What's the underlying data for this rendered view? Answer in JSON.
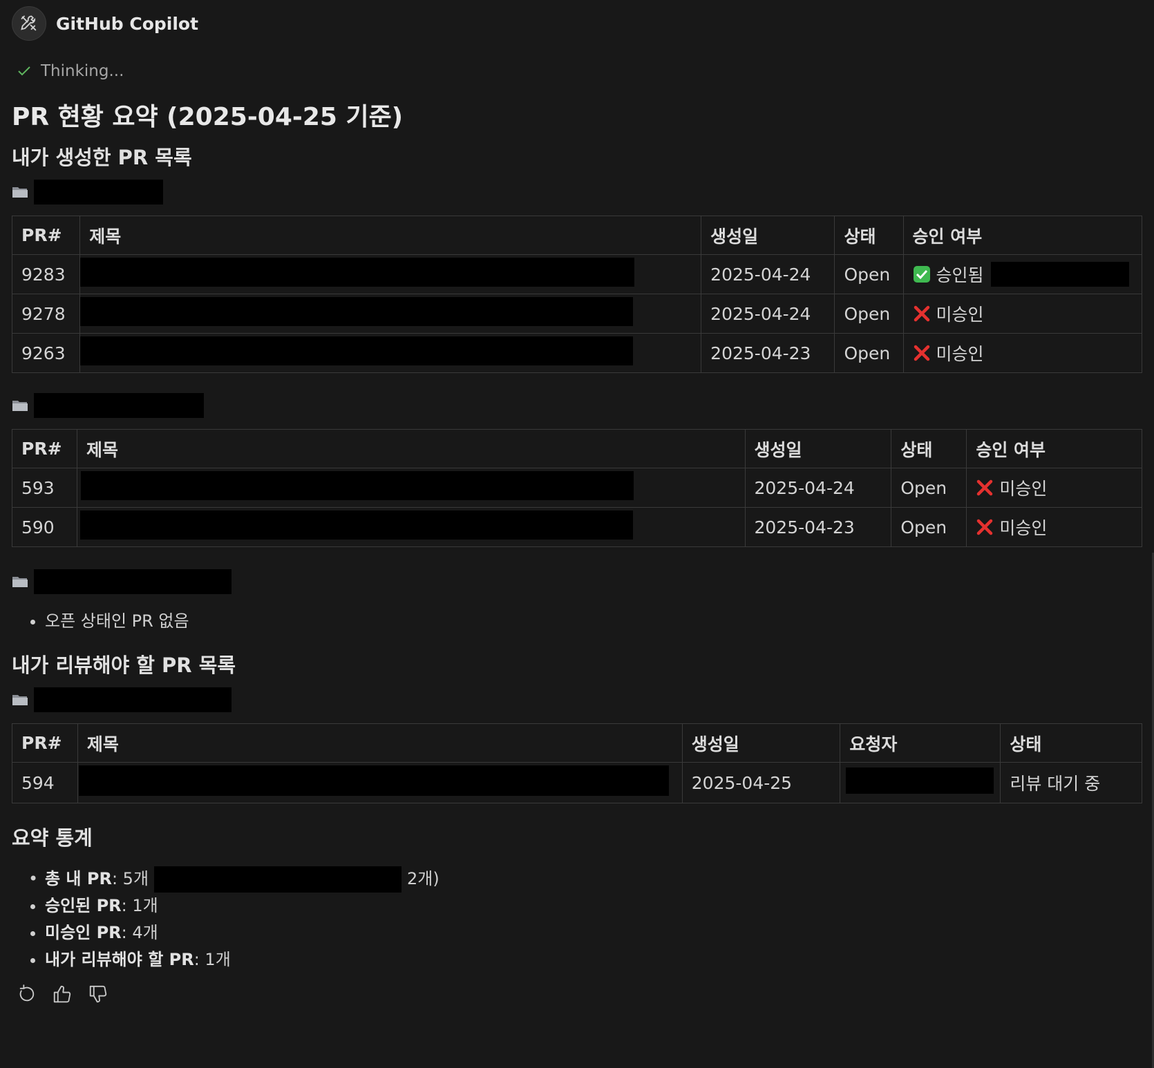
{
  "header": {
    "agent_name": "GitHub Copilot",
    "avatar_icon": "tools-icon"
  },
  "status": {
    "text": "Thinking...",
    "icon": "check-icon",
    "color": "#5fb55f"
  },
  "title": "PR 현황 요약 (2025-04-25 기준)",
  "sections": {
    "mine": "내가 생성한 PR 목록",
    "review": "내가 리뷰해야 할 PR 목록",
    "stats": "요약 통계"
  },
  "repo1": {
    "headers": [
      "PR#",
      "제목",
      "생성일",
      "상태",
      "승인 여부"
    ],
    "rows": [
      {
        "num": "9283",
        "date": "2025-04-24",
        "status": "Open",
        "approval": "승인됨",
        "approved": true
      },
      {
        "num": "9278",
        "date": "2025-04-24",
        "status": "Open",
        "approval": "미승인",
        "approved": false
      },
      {
        "num": "9263",
        "date": "2025-04-23",
        "status": "Open",
        "approval": "미승인",
        "approved": false
      }
    ]
  },
  "repo2": {
    "headers": [
      "PR#",
      "제목",
      "생성일",
      "상태",
      "승인 여부"
    ],
    "rows": [
      {
        "num": "593",
        "date": "2025-04-24",
        "status": "Open",
        "approval": "미승인",
        "approved": false
      },
      {
        "num": "590",
        "date": "2025-04-23",
        "status": "Open",
        "approval": "미승인",
        "approved": false
      }
    ]
  },
  "repo3": {
    "note": "오픈 상태인 PR 없음"
  },
  "review_repo": {
    "headers": [
      "PR#",
      "제목",
      "생성일",
      "요청자",
      "상태"
    ],
    "rows": [
      {
        "num": "594",
        "date": "2025-04-25",
        "status": "리뷰 대기 중"
      }
    ]
  },
  "stats": [
    {
      "label": "총 내 PR",
      "value": ": 5개",
      "tail": "2개)"
    },
    {
      "label": "승인된 PR",
      "value": ": 1개"
    },
    {
      "label": "미승인 PR",
      "value": ": 4개"
    },
    {
      "label": "내가 리뷰해야 할 PR",
      "value": ": 1개"
    }
  ],
  "footer_icons": [
    "retry-icon",
    "thumbs-up-icon",
    "thumbs-down-icon"
  ],
  "colors": {
    "background": "#181818",
    "approved": "#3fb950",
    "rejected": "#e5312f"
  }
}
